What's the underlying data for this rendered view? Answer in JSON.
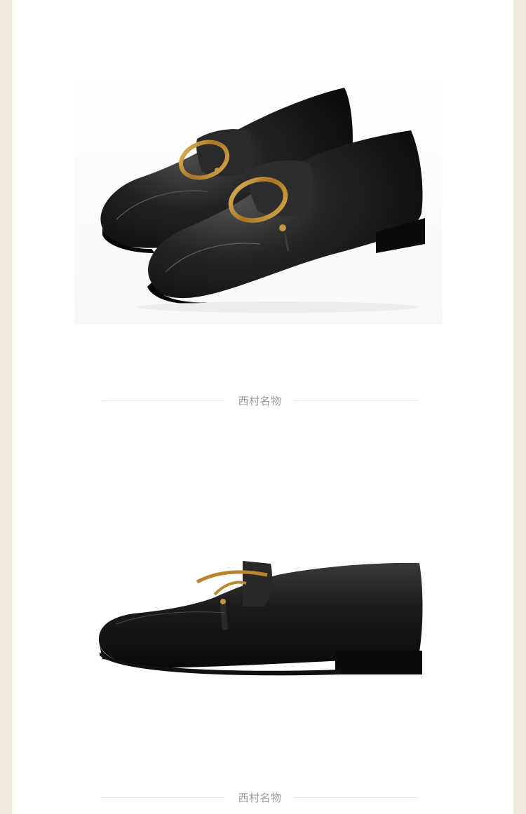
{
  "dividers": [
    {
      "caption": "西村名物"
    },
    {
      "caption": "西村名物"
    }
  ],
  "images": [
    {
      "subject": "pair-of-black-leather-loafers-with-gold-horsebit"
    },
    {
      "subject": "single-black-leather-loafer-side-view"
    }
  ],
  "colors": {
    "outer_background": "#f1eadb",
    "panel": "#ffffff",
    "caption_text": "#9a9a9a",
    "divider_line": "#e7e7e7",
    "leather": "#1a1a1a",
    "buckle": "#b8862f"
  }
}
